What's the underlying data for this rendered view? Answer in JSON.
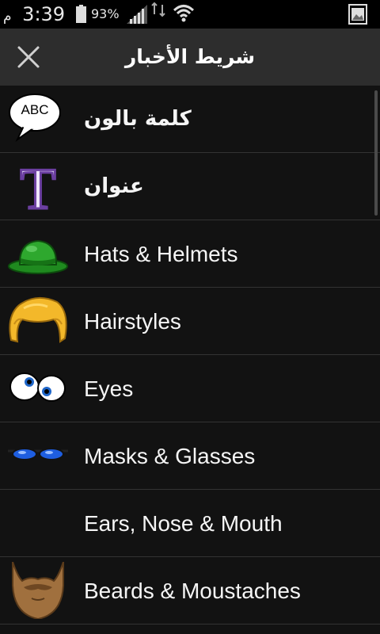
{
  "status_bar": {
    "time": "3:39",
    "ampm": "م",
    "battery": "93%"
  },
  "header": {
    "title": "شريط الأخبار",
    "close_icon": "close-icon"
  },
  "list": {
    "items": [
      {
        "label": "كلمة بالون",
        "icon": "speech-bubble-icon",
        "bubble_text": "ABC",
        "rtl": true
      },
      {
        "label": "عنوان",
        "icon": "title-t-icon",
        "glyph": "T",
        "rtl": true
      },
      {
        "label": "Hats & Helmets",
        "icon": "green-hat-icon"
      },
      {
        "label": "Hairstyles",
        "icon": "blonde-hair-icon"
      },
      {
        "label": "Eyes",
        "icon": "cartoon-eyes-icon"
      },
      {
        "label": "Masks & Glasses",
        "icon": "blue-glasses-icon"
      },
      {
        "label": "Ears, Nose & Mouth",
        "icon": ""
      },
      {
        "label": "Beards & Moustaches",
        "icon": "beard-icon"
      }
    ]
  },
  "colors": {
    "header_bg": "#2d2d2d",
    "list_bg": "#121212",
    "divider": "#333333",
    "text": "#ffffff"
  }
}
